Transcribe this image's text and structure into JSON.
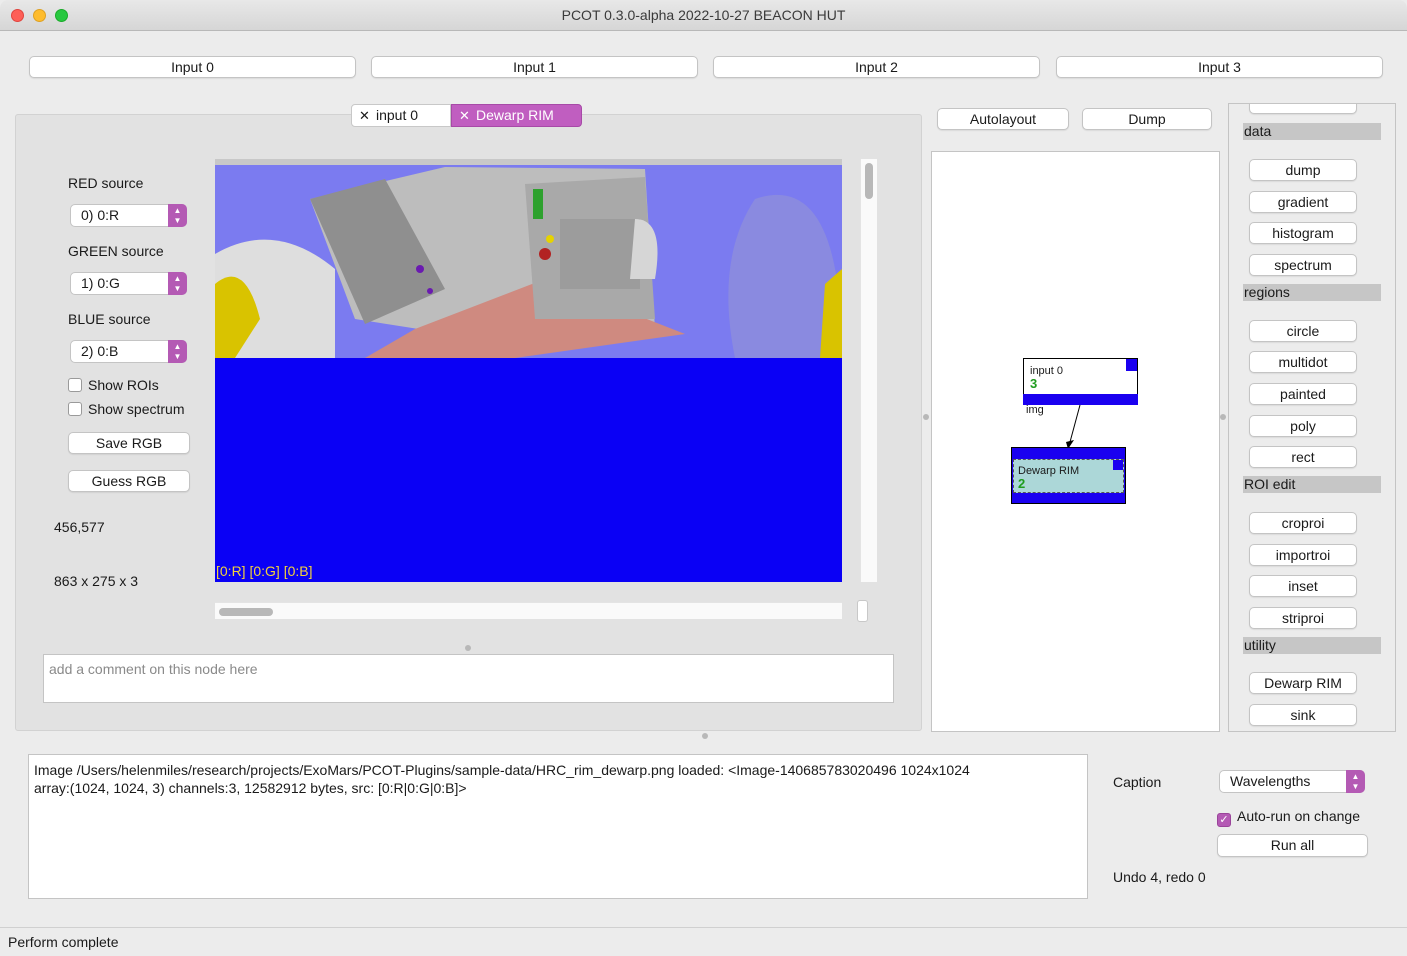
{
  "window": {
    "title": "PCOT 0.3.0-alpha 2022-10-27 BEACON HUT"
  },
  "inputs": [
    {
      "label": "Input 0"
    },
    {
      "label": "Input 1"
    },
    {
      "label": "Input 2"
    },
    {
      "label": "Input 3"
    }
  ],
  "tabs": [
    {
      "label": "input 0",
      "active": false
    },
    {
      "label": "Dewarp RIM",
      "active": true
    }
  ],
  "node_panel": {
    "red_label": "RED source",
    "red_value": "0) 0:R",
    "green_label": "GREEN source",
    "green_value": "1) 0:G",
    "blue_label": "BLUE source",
    "blue_value": "2) 0:B",
    "show_rois_label": "Show ROIs",
    "show_rois_checked": false,
    "show_spectrum_label": "Show spectrum",
    "show_spectrum_checked": false,
    "save_rgb_label": "Save RGB",
    "guess_rgb_label": "Guess RGB",
    "coords": "456,577",
    "dims": "863 x 275 x 3",
    "image_caption": "[0:R] [0:G] [0:B]",
    "comment_placeholder": "add a comment on this node here"
  },
  "graph_toolbar": {
    "autolayout_label": "Autolayout",
    "dump_label": "Dump"
  },
  "graph": {
    "nodes": [
      {
        "title": "input 0",
        "number": "3",
        "output_label": "img"
      },
      {
        "title": "Dewarp RIM",
        "number": "2"
      }
    ]
  },
  "palette": {
    "sections": [
      {
        "title": "data",
        "items": [
          "dump",
          "gradient",
          "histogram",
          "spectrum"
        ]
      },
      {
        "title": "regions",
        "items": [
          "circle",
          "multidot",
          "painted",
          "poly",
          "rect"
        ]
      },
      {
        "title": "ROI edit",
        "items": [
          "croproi",
          "importroi",
          "inset",
          "striproi"
        ]
      },
      {
        "title": "utility",
        "items": [
          "Dewarp RIM",
          "sink"
        ]
      }
    ]
  },
  "log": {
    "line1": "Image /Users/helenmiles/research/projects/ExoMars/PCOT-Plugins/sample-data/HRC_rim_dewarp.png loaded: <Image-140685783020496 1024x1024",
    "line2": "array:(1024, 1024, 3) channels:3, 12582912 bytes, src: [0:R|0:G|0:B]>"
  },
  "controls": {
    "caption_label": "Caption",
    "caption_value": "Wavelengths",
    "autorun_label": "Auto-run on change",
    "autorun_checked": true,
    "run_all_label": "Run all",
    "undo_status": "Undo 4, redo 0"
  },
  "status_bar": {
    "text": "Perform complete"
  },
  "colors": {
    "accent": "#b45ab4",
    "active_tab": "#c05ec0",
    "image_bg": "#0a00f5",
    "image_caption": "#f3d23a",
    "node_bar": "#1a00f0",
    "node_selected_fill": "#acd7d8",
    "node_number": "#1f9c1f"
  }
}
